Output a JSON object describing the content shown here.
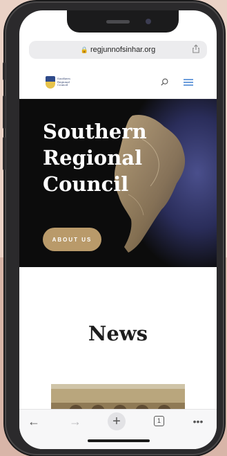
{
  "browser": {
    "url": "regjunnofsinhar.org",
    "tab_count": "1"
  },
  "site": {
    "logo_text": "Southern Regional Council"
  },
  "hero": {
    "title": "Southern\nRegional\nCouncil",
    "button_label": "ABOUT US"
  },
  "news": {
    "title": "News"
  },
  "icons": {
    "lock": "lock-icon",
    "share": "share-icon",
    "search": "search-icon",
    "menu": "hamburger-menu-icon",
    "back": "back-arrow-icon",
    "forward": "forward-arrow-icon",
    "new_tab": "plus-icon",
    "tabs": "tabs-icon",
    "more": "more-icon"
  },
  "colors": {
    "accent_button": "#b99a6a",
    "menu_icon": "#3d7fd0",
    "hero_background": "#0c0c0c"
  }
}
